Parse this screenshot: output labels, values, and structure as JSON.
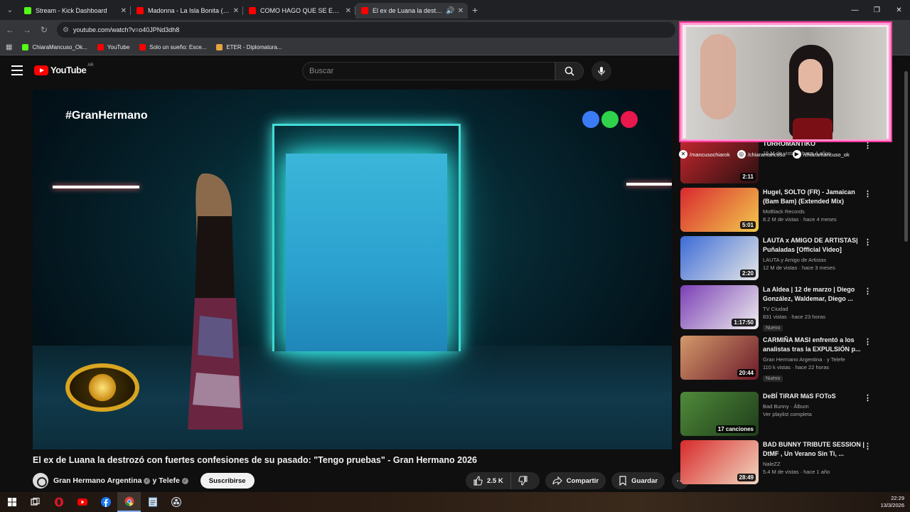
{
  "tabs": [
    {
      "title": "Stream - Kick Dashboard",
      "favicon_color": "#53fc18",
      "active": false
    },
    {
      "title": "Madonna - La Isla Bonita (millih",
      "favicon_color": "#ff0000",
      "active": false
    },
    {
      "title": "COMO HAGO QUE SE ESCUCHE",
      "favicon_color": "#ff0000",
      "active": false
    },
    {
      "title": "El ex de Luana la destrozó c",
      "favicon_color": "#ff0000",
      "active": true
    }
  ],
  "address": {
    "url": "youtube.com/watch?v=o40JPNd3dh8"
  },
  "bookmarks": [
    {
      "label": "ChiaraMancuso_Ok...",
      "color": "#53fc18"
    },
    {
      "label": "YouTube",
      "color": "#ff0000"
    },
    {
      "label": "Solo un sueño: Esce...",
      "color": "#ff0000"
    },
    {
      "label": "ETER - Diplomatura...",
      "color": "#e8a33d"
    }
  ],
  "youtube": {
    "logo_text": "YouTube",
    "country_code": "AR",
    "search_placeholder": "Buscar"
  },
  "player": {
    "hashtag": "#GranHermano",
    "dot_colors": [
      "#3b7cf5",
      "#2fd24a",
      "#e8174e"
    ]
  },
  "video": {
    "title": "El ex de Luana la destrozó con fuertes confesiones de su pasado: \"Tengo pruebas\" - Gran Hermano 2026",
    "channel": "Gran Hermano Argentina",
    "channel_joiner": "y Telefe",
    "subscribe_label": "Suscribirse",
    "likes": "2.5 K",
    "share_label": "Compartir",
    "save_label": "Guardar"
  },
  "overlay": {
    "socials": [
      {
        "icon": "x-icon",
        "glyph": "✕",
        "handle": "/mancusochiarok"
      },
      {
        "icon": "instagram-icon",
        "glyph": "◎",
        "handle": "/chiaramancuso"
      },
      {
        "icon": "kick-icon",
        "glyph": "▶",
        "handle": "/chiaramancuso_ok"
      }
    ]
  },
  "recommendations": [
    {
      "title": "TURROMANTIKO",
      "channel": "",
      "views": "15 M de vistas · hace 4 años",
      "duration": "2:11",
      "badge": "",
      "thumb": [
        "#c1272d",
        "#2a0f10"
      ]
    },
    {
      "title": "Hugel, SOLTO (FR) - Jamaican (Bam Bam) (Extended Mix)",
      "channel": "MoBlack Records",
      "views": "8.2 M de vistas · hace 4 meses",
      "duration": "5:01",
      "badge": "",
      "thumb": [
        "#d9282f",
        "#f2c94c"
      ]
    },
    {
      "title": "LAUTA x AMIGO DE ARTISTAS| Puñaladas [Official Video]",
      "channel": "LAUTA y Amigo de Artistas",
      "views": "12 M de vistas · hace 3 meses",
      "duration": "2:20",
      "badge": "",
      "thumb": [
        "#3b6bd6",
        "#e6e6e6"
      ]
    },
    {
      "title": "La Aldea | 12 de marzo | Diego González, Waldemar, Diego ...",
      "channel": "TV Ciudad",
      "views": "831 vistas · hace 23 horas",
      "duration": "1:17:50",
      "badge": "Nuevo",
      "thumb": [
        "#7b3fb5",
        "#eeeeee"
      ]
    },
    {
      "title": "CARMIÑA MASI enfrentó a los analistas tras la EXPULSIÓN p...",
      "channel": "Gran Hermano Argentina · y Telefe",
      "views": "110 k vistas · hace 22 horas",
      "duration": "20:44",
      "badge": "Nuevo",
      "thumb": [
        "#d49a6a",
        "#6b1a2a"
      ]
    },
    {
      "title": "DeBÍ TiRAR MáS FOToS",
      "channel": "Bad Bunny · Álbum",
      "views": "Ver playlist completa",
      "duration": "17 canciones",
      "badge": "",
      "thumb": [
        "#4f8a3a",
        "#1f3d1a"
      ]
    },
    {
      "title": "BAD BUNNY TRIBUTE SESSION | DtMF , Un Verano Sin Ti, ...",
      "channel": "NaleZZ",
      "views": "5.4 M de vistas · hace 1 año",
      "duration": "28:49",
      "badge": "",
      "thumb": [
        "#d92a2a",
        "#f0d7c0"
      ]
    }
  ],
  "clock": {
    "time": "22:29",
    "date": "13/3/2026"
  }
}
